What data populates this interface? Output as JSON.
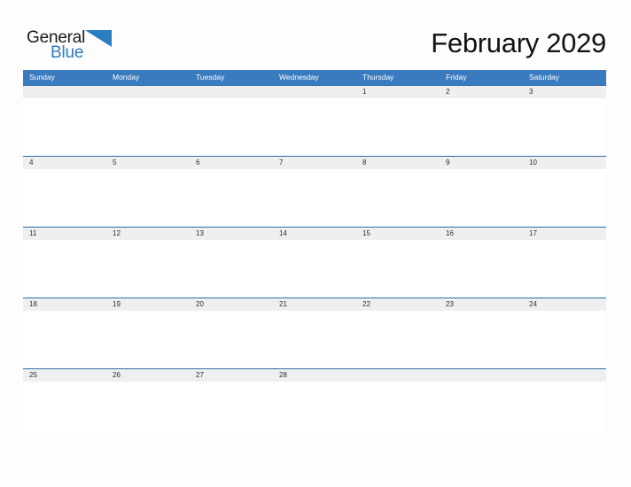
{
  "brand": {
    "name_line1": "General",
    "name_line2": "Blue",
    "flag_icon": "triangle-flag-icon",
    "color_dark": "#1a1a1a",
    "color_blue": "#2b7cc0"
  },
  "calendar": {
    "title": "February 2029",
    "month": "February",
    "year": "2029",
    "header_color": "#3a7bbf",
    "band_color": "#efefef",
    "rule_color": "#2f6fa8",
    "weekdays": [
      "Sunday",
      "Monday",
      "Tuesday",
      "Wednesday",
      "Thursday",
      "Friday",
      "Saturday"
    ],
    "weeks": [
      [
        "",
        "",
        "",
        "",
        "1",
        "2",
        "3"
      ],
      [
        "4",
        "5",
        "6",
        "7",
        "8",
        "9",
        "10"
      ],
      [
        "11",
        "12",
        "13",
        "14",
        "15",
        "16",
        "17"
      ],
      [
        "18",
        "19",
        "20",
        "21",
        "22",
        "23",
        "24"
      ],
      [
        "25",
        "26",
        "27",
        "28",
        "",
        "",
        ""
      ]
    ]
  }
}
